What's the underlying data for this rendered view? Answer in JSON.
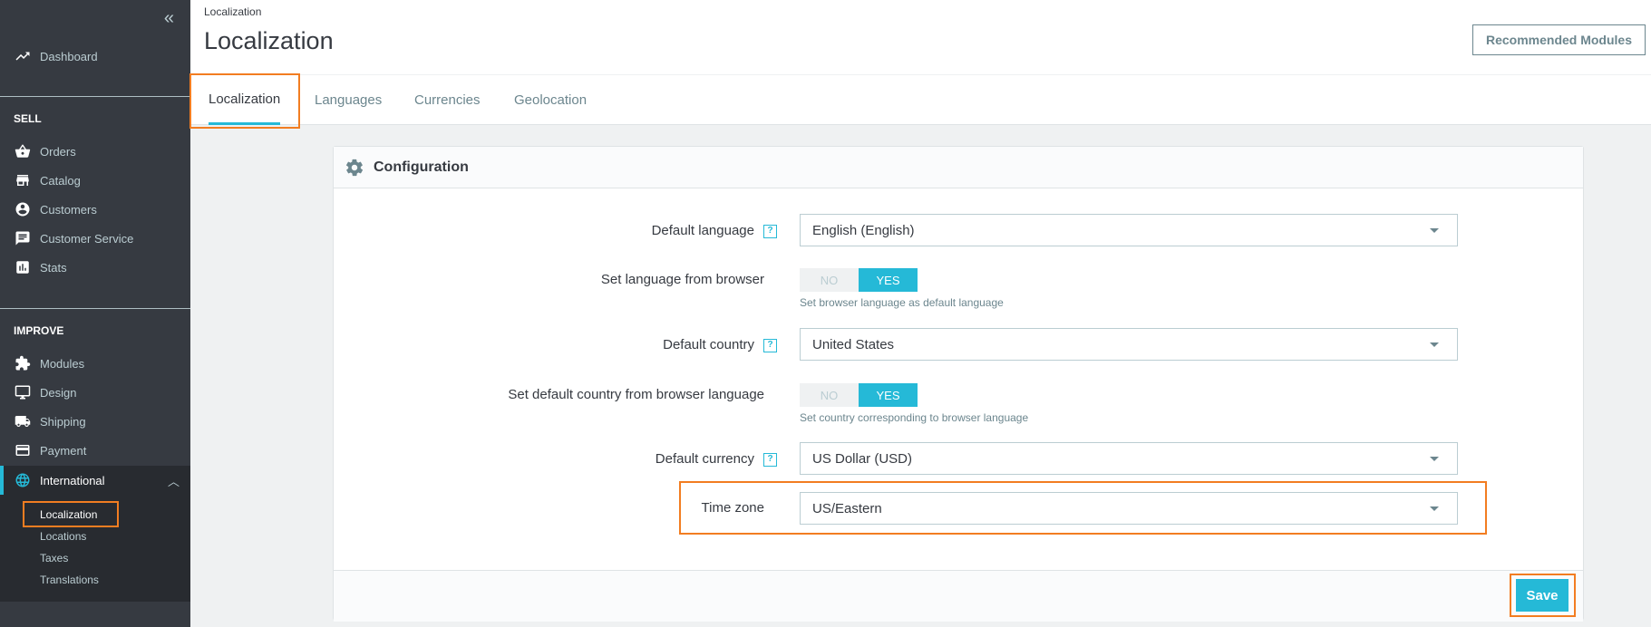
{
  "sidebar": {
    "collapse_icon": "double-chevron-left-icon",
    "dashboard": "Dashboard",
    "sell_heading": "SELL",
    "sell_items": [
      {
        "label": "Orders",
        "icon": "basket-icon"
      },
      {
        "label": "Catalog",
        "icon": "store-icon"
      },
      {
        "label": "Customers",
        "icon": "account-circle-icon"
      },
      {
        "label": "Customer Service",
        "icon": "chat-icon"
      },
      {
        "label": "Stats",
        "icon": "bar-chart-icon"
      }
    ],
    "improve_heading": "IMPROVE",
    "improve_items": [
      {
        "label": "Modules",
        "icon": "puzzle-icon"
      },
      {
        "label": "Design",
        "icon": "desktop-icon"
      },
      {
        "label": "Shipping",
        "icon": "truck-icon"
      },
      {
        "label": "Payment",
        "icon": "credit-card-icon"
      },
      {
        "label": "International",
        "icon": "globe-icon"
      }
    ],
    "international_sub": [
      "Localization",
      "Locations",
      "Taxes",
      "Translations"
    ]
  },
  "header": {
    "breadcrumb": "Localization",
    "title": "Localization",
    "recommended_modules": "Recommended Modules"
  },
  "tabs": [
    "Localization",
    "Languages",
    "Currencies",
    "Geolocation"
  ],
  "card": {
    "title": "Configuration",
    "fields": {
      "default_language": {
        "label": "Default language",
        "value": "English (English)"
      },
      "lang_from_browser": {
        "label": "Set language from browser",
        "no": "NO",
        "yes": "YES",
        "hint": "Set browser language as default language"
      },
      "default_country": {
        "label": "Default country",
        "value": "United States"
      },
      "country_from_browser": {
        "label": "Set default country from browser language",
        "no": "NO",
        "yes": "YES",
        "hint": "Set country corresponding to browser language"
      },
      "default_currency": {
        "label": "Default currency",
        "value": "US Dollar (USD)"
      },
      "time_zone": {
        "label": "Time zone",
        "value": "US/Eastern"
      }
    },
    "help_glyph": "?",
    "save": "Save"
  },
  "colors": {
    "accent": "#25b9d7",
    "highlight": "#f27d21",
    "sidebar": "#363a41"
  }
}
